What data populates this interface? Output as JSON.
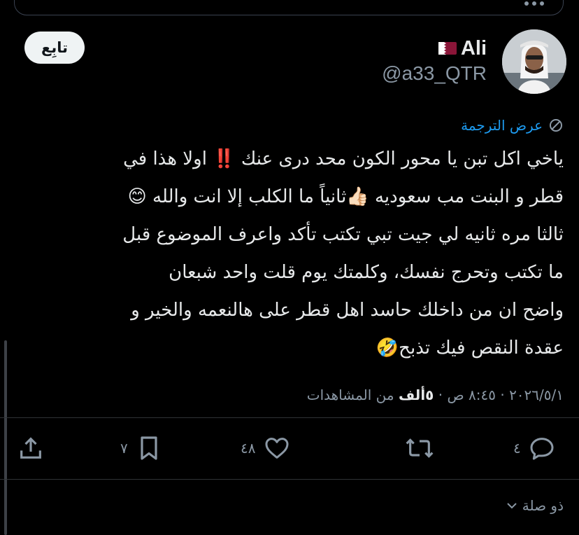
{
  "header": {
    "author_name": "Ali",
    "handle": "@a33_QTR",
    "follow_label": "تابِع"
  },
  "translate_label": "عرض الترجمة",
  "tweet": {
    "lines": [
      "ياخي اكل تبن يا محور الكون محد درى عنك ‼️ اولا هذا في",
      "قطر و البنت مب سعوديه 👍🏻ثانياً ما الكلب إلا انت والله 😊",
      "ثالثا مره ثانيه لي جيت تبي تكتب تأكد واعرف الموضوع قبل",
      "ما تكتب وتحرج نفسك، وكلمتك يوم قلت واحد شبعان",
      "واضح ان من داخلك حاسد اهل قطر على هالنعمه والخير و",
      "عقدة النقص فيك تذبح🤣"
    ]
  },
  "meta": {
    "date": "٢٠٢٦/٥/١",
    "time": "٨:٤٥ ص",
    "views_count": "٥ألف",
    "views_label": "من المشاهدات"
  },
  "actions": {
    "replies": "٤",
    "likes": "٤٨",
    "bookmarks": "٧"
  },
  "related_label": "ذو صلة",
  "colors": {
    "background": "#000000",
    "text": "#e7e9ea",
    "secondary": "#8b98a5",
    "accent": "#1d9bf0",
    "flag": "#8a1538"
  },
  "icons": {
    "more": "more-icon",
    "translate": "translate-icon",
    "reply": "reply-icon",
    "repost": "repost-icon",
    "like": "heart-icon",
    "bookmark": "bookmark-icon",
    "share": "share-icon",
    "chevron": "chevron-down-icon"
  }
}
